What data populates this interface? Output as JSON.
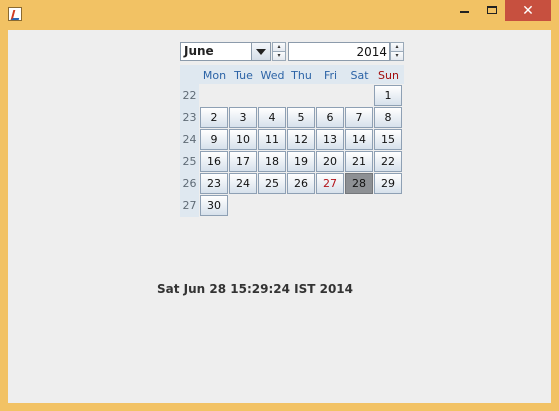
{
  "window": {
    "minimize_icon": "minimize-icon",
    "maximize_icon": "maximize-icon",
    "close_icon": "close-icon",
    "close_glyph": "✕",
    "frame_color": "#f2c264",
    "close_color": "#c7503f"
  },
  "calendar": {
    "month": "June",
    "year": "2014",
    "weekdays": [
      "Mon",
      "Tue",
      "Wed",
      "Thu",
      "Fri",
      "Sat",
      "Sun"
    ],
    "week_numbers": [
      "22",
      "23",
      "24",
      "25",
      "26",
      "27"
    ],
    "days": [
      [
        "",
        "",
        "",
        "",
        "",
        "",
        "1"
      ],
      [
        "2",
        "3",
        "4",
        "5",
        "6",
        "7",
        "8"
      ],
      [
        "9",
        "10",
        "11",
        "12",
        "13",
        "14",
        "15"
      ],
      [
        "16",
        "17",
        "18",
        "19",
        "20",
        "21",
        "22"
      ],
      [
        "23",
        "24",
        "25",
        "26",
        "27",
        "28",
        "29"
      ],
      [
        "30",
        "",
        "",
        "",
        "",
        "",
        ""
      ]
    ],
    "today": "27",
    "selected_day": "28",
    "accent_color": "#2c63a6",
    "sunday_color": "#a10b0b"
  },
  "status": {
    "selected_datetime": "Sat Jun 28 15:29:24 IST 2014"
  }
}
